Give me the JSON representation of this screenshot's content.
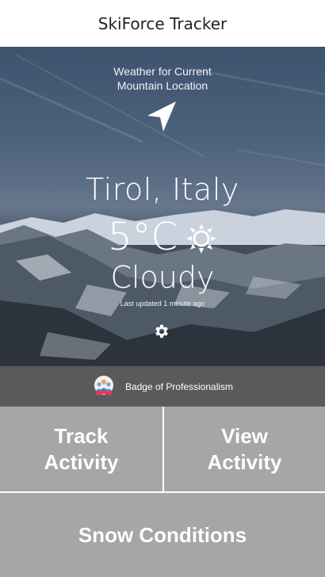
{
  "header": {
    "title": "SkiForce Tracker"
  },
  "weather": {
    "caption_line1": "Weather for Current",
    "caption_line2": "Mountain Location",
    "location": "Tirol, Italy",
    "temperature": "5°C",
    "condition": "Cloudy",
    "last_updated": "Last updated 1 minute ago",
    "icons": {
      "navigate": "navigation-arrow-icon",
      "condition": "sun-icon",
      "settings": "gear-icon"
    }
  },
  "badge": {
    "label": "Badge of Professionalism",
    "icon": "badge-icon"
  },
  "tiles": {
    "track_line1": "Track",
    "track_line2": "Activity",
    "view_line1": "View",
    "view_line2": "Activity",
    "snow": "Snow Conditions"
  },
  "colors": {
    "tile": "#a6a6a6",
    "badge_bar": "#5a5a5a",
    "header_bg": "#ffffff"
  }
}
